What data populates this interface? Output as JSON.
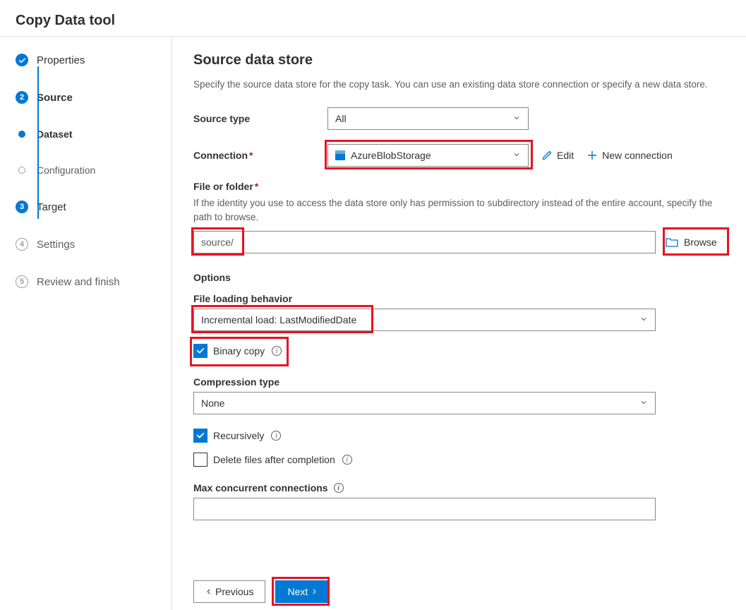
{
  "header": {
    "title": "Copy Data tool"
  },
  "sidebar": {
    "steps": {
      "properties": "Properties",
      "source": "Source",
      "dataset": "Dataset",
      "configuration": "Configuration",
      "target": "Target",
      "settings": "Settings",
      "review": "Review and finish"
    },
    "nums": {
      "source": "2",
      "target": "3",
      "settings": "4",
      "review": "5"
    }
  },
  "main": {
    "title": "Source data store",
    "desc": "Specify the source data store for the copy task. You can use an existing data store connection or specify a new data store.",
    "sourceType": {
      "label": "Source type",
      "value": "All"
    },
    "connection": {
      "label": "Connection",
      "value": "AzureBlobStorage",
      "edit": "Edit",
      "newConn": "New connection"
    },
    "fileFolder": {
      "label": "File or folder",
      "hint": "If the identity you use to access the data store only has permission to subdirectory instead of the entire account, specify the path to browse.",
      "value": "source/",
      "browse": "Browse"
    },
    "options": {
      "title": "Options",
      "fileLoading": {
        "label": "File loading behavior",
        "value": "Incremental load: LastModifiedDate"
      },
      "binaryCopy": {
        "label": "Binary copy",
        "checked": true
      },
      "compression": {
        "label": "Compression type",
        "value": "None"
      },
      "recursively": {
        "label": "Recursively",
        "checked": true
      },
      "deleteAfter": {
        "label": "Delete files after completion",
        "checked": false
      },
      "maxConn": {
        "label": "Max concurrent connections",
        "value": ""
      }
    }
  },
  "footer": {
    "previous": "Previous",
    "next": "Next"
  }
}
